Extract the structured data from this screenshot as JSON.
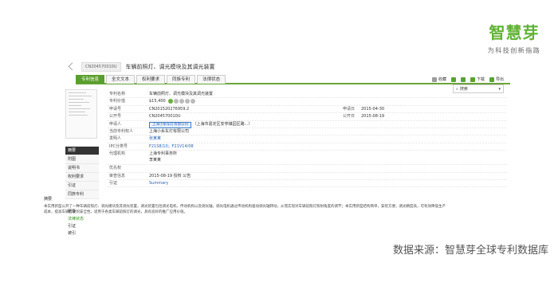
{
  "brand": {
    "name": "智慧芽",
    "slogan": "为科技创新指路"
  },
  "titlebar": {
    "publication_no": "CN204570010U",
    "title": "车辆前照灯、调光模块及其调光装置"
  },
  "tabs": [
    {
      "label": "专利信息",
      "active": true
    },
    {
      "label": "全文文本",
      "active": false
    },
    {
      "label": "权利要求",
      "active": false
    },
    {
      "label": "同族专利",
      "active": false
    },
    {
      "label": "法律状态",
      "active": false
    }
  ],
  "toolbar": {
    "items": [
      {
        "label": "收藏",
        "icon": "star-icon",
        "color": "#9b9b9b"
      },
      {
        "label": "",
        "icon": "plus-icon",
        "color": "#5aa232"
      },
      {
        "label": "",
        "icon": "star-icon",
        "color": "#5aa232"
      },
      {
        "label": "下载",
        "icon": "download-icon",
        "color": "#5aa232"
      },
      {
        "label": "导出",
        "icon": "export-icon",
        "color": "#5aa232"
      }
    ]
  },
  "search_pop": {
    "placeholder": "搜索"
  },
  "left_nav": {
    "items": [
      {
        "label": "摘要",
        "active": true
      },
      {
        "label": "附图",
        "active": false
      },
      {
        "label": "说明书",
        "active": false
      },
      {
        "label": "权利要求",
        "active": false
      },
      {
        "label": "引证",
        "active": false
      },
      {
        "label": "同族专利",
        "active": false
      }
    ],
    "sub_items": [
      {
        "label": "著录",
        "green": false
      },
      {
        "label": "法律状态",
        "green": true
      },
      {
        "label": "引证",
        "green": false
      },
      {
        "label": "被引",
        "green": false
      }
    ]
  },
  "info": {
    "rows": [
      {
        "label": "专利名称",
        "value": "车辆前照灯、调光模块及其调光装置"
      },
      {
        "label": "专利价值",
        "value": "$15,400",
        "dots": 5
      },
      {
        "label": "申请号",
        "value": "CN201520276959.2",
        "right_label": "申请日",
        "right_value": "2015-04-30"
      },
      {
        "label": "公开号",
        "value": "CN204570010U",
        "right_label": "公开日",
        "right_value": "2015-08-19"
      },
      {
        "label": "申请人",
        "value": "",
        "badge": "上海小糸车灯有限公司",
        "extra": "（上海市嘉定区安亭镇园区路...）"
      },
      {
        "label": "当前专利权人",
        "value": "上海小糸车灯有限公司"
      },
      {
        "label": "发明人",
        "value": "张某某",
        "link": true
      },
      {
        "label": "IPC分类号",
        "value": "F21S8/10；F21V14/08",
        "link": true
      },
      {
        "label": "代理机构",
        "value": "上海专利事务所",
        "value2": "李某某"
      },
      {
        "label": "优先权",
        "value": ""
      },
      {
        "label": "审查信息",
        "value": "2015-08-19 授权 公告"
      },
      {
        "label": "引证",
        "value": "Summary",
        "link": true
      }
    ]
  },
  "abstract": {
    "heading": "摘要",
    "text": "本实用新型公开了一种车辆前照灯、调光模块及其调光装置，调光装置包括调光电机、传动机构以及调光轴，调光电机通过传动机构驱动调光轴转动，从而实现对车辆前照灯照射角度的调节；本实用新型结构简单，安装方便，调光精度高，可有效降低生产成本，提高车辆行驶的安全性，适用于各类车辆前照灯的调光，具有良好的推广应用价值。"
  },
  "source": "数据来源：智慧芽全球专利数据库"
}
